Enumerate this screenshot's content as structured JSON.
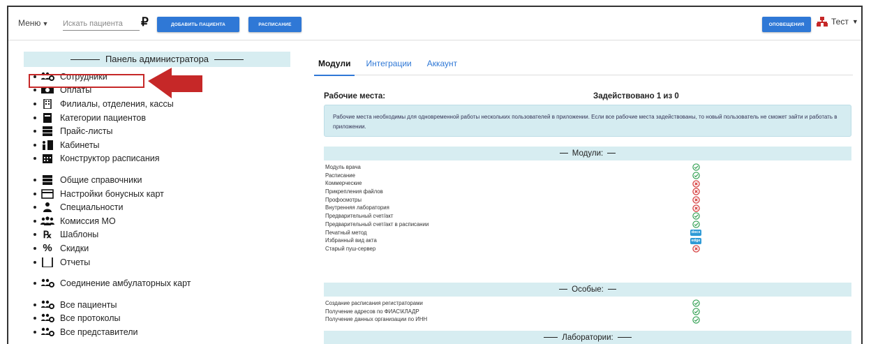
{
  "topbar": {
    "menu_label": "Меню",
    "search_placeholder": "Искать пациента",
    "currency_symbol": "₽",
    "add_patient_label": "ДОБАВИТЬ ПАЦИЕНТА",
    "schedule_label": "РАСПИСАНИЕ",
    "notifications_label": "ОПОВЕЩЕНИЯ",
    "user_name": "Тест"
  },
  "sidebar": {
    "title": "Панель администратора",
    "items": [
      {
        "label": "Сотрудники",
        "icon": "users-icon"
      },
      {
        "label": "Оплаты",
        "icon": "money-icon"
      },
      {
        "label": "Филиалы, отделения, кассы",
        "icon": "building-icon"
      },
      {
        "label": "Категории пациентов",
        "icon": "card-icon"
      },
      {
        "label": "Прайс-листы",
        "icon": "list-icon"
      },
      {
        "label": "Кабинеты",
        "icon": "door-icon"
      },
      {
        "label": "Конструктор расписания",
        "icon": "calendar-icon"
      },
      {
        "label": "Общие справочники",
        "icon": "list-icon"
      },
      {
        "label": "Настройки бонусных карт",
        "icon": "credit-card-icon"
      },
      {
        "label": "Специальности",
        "icon": "doctor-icon"
      },
      {
        "label": "Комиссия МО",
        "icon": "group-icon"
      },
      {
        "label": "Шаблоны",
        "icon": "prescription-icon"
      },
      {
        "label": "Скидки",
        "icon": "percent-icon"
      },
      {
        "label": "Отчеты",
        "icon": "report-icon"
      },
      {
        "label": "Соединение амбулаторных карт",
        "icon": "users-icon"
      },
      {
        "label": "Все пациенты",
        "icon": "users-icon"
      },
      {
        "label": "Все протоколы",
        "icon": "users-icon"
      },
      {
        "label": "Все представители",
        "icon": "users-icon"
      }
    ]
  },
  "tabs": [
    {
      "label": "Модули",
      "active": true
    },
    {
      "label": "Интеграции",
      "active": false
    },
    {
      "label": "Аккаунт",
      "active": false
    }
  ],
  "workplaces": {
    "label": "Рабочие места:",
    "used": "Задействовано 1 из 0",
    "info": "Рабочие места необходимы для одновременной работы нескольких пользователей в приложении. Если все рабочие места задействованы, то новый пользователь не сможет зайти и работать в приложении."
  },
  "sections": {
    "modules_title": "Модули:",
    "special_title": "Особые:",
    "labs_title": "Лаборатории:"
  },
  "modules": [
    {
      "name": "Модуль врача",
      "status": "ok"
    },
    {
      "name": "Расписание",
      "status": "ok"
    },
    {
      "name": "Коммерческие",
      "status": "no"
    },
    {
      "name": "Прикрепления файлов",
      "status": "no"
    },
    {
      "name": "Профосмотры",
      "status": "no"
    },
    {
      "name": "Внутренняя лаборатория",
      "status": "no"
    },
    {
      "name": "Предварительный счет/акт",
      "status": "ok"
    },
    {
      "name": "Предварительный счет/акт в расписании",
      "status": "ok"
    },
    {
      "name": "Печатный метод",
      "status": "badge",
      "badge": "docx"
    },
    {
      "name": "Избранный вид акта",
      "status": "badge",
      "badge": "edge"
    },
    {
      "name": "Старый пуш-сервер",
      "status": "no"
    }
  ],
  "special": [
    {
      "name": "Создание расписания регистраторами",
      "status": "ok"
    },
    {
      "name": "Получение адресов по ФИАС\\КЛАДР",
      "status": "ok"
    },
    {
      "name": "Получение данных организации по ИНН",
      "status": "ok"
    }
  ],
  "colors": {
    "primary": "#2f78d6",
    "header_bg": "#d7edf1",
    "ok": "#2e9e4f",
    "error": "#d32f2f",
    "highlight": "#c62828"
  }
}
